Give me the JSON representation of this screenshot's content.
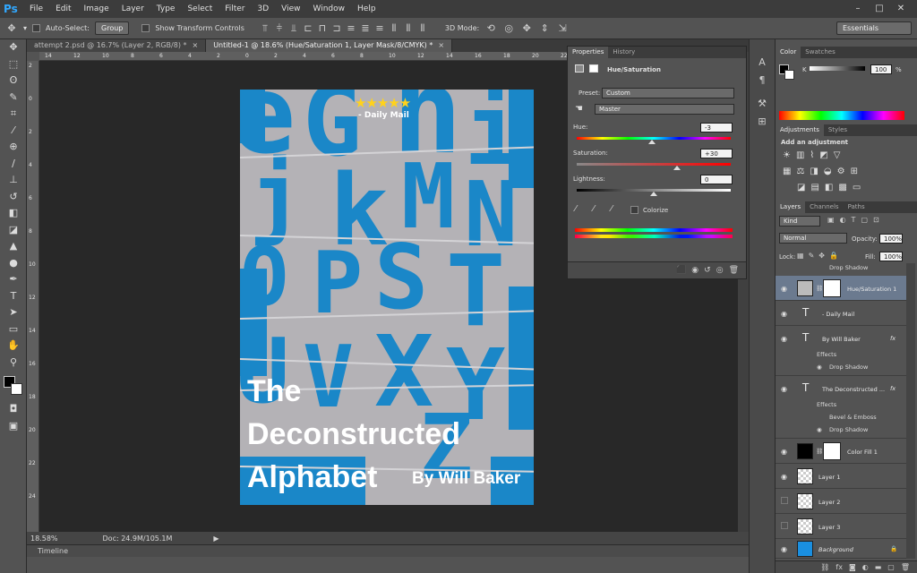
{
  "app": {
    "logo": "Ps"
  },
  "menu": [
    "File",
    "Edit",
    "Image",
    "Layer",
    "Type",
    "Select",
    "Filter",
    "3D",
    "View",
    "Window",
    "Help"
  ],
  "window_controls": [
    "–",
    "□",
    "✕"
  ],
  "options": {
    "auto_select_label": "Auto-Select:",
    "auto_select_value": "Group",
    "transform_label": "Show Transform Controls",
    "mode_label": "3D Mode:",
    "workspace": "Essentials"
  },
  "doc_tabs": [
    {
      "label": "attempt 2.psd @ 16.7% (Layer 2, RGB/8) *",
      "active": false
    },
    {
      "label": "Untitled-1 @ 18.6% (Hue/Saturation 1, Layer Mask/8/CMYK) *",
      "active": true
    }
  ],
  "tab_close": "×",
  "ruler": {
    "h": [
      "14",
      "12",
      "10",
      "8",
      "6",
      "4",
      "2",
      "0",
      "2",
      "4",
      "6",
      "8",
      "10",
      "12",
      "14",
      "16",
      "18",
      "20",
      "22"
    ],
    "v": [
      "2",
      "0",
      "2",
      "4",
      "6",
      "8",
      "10",
      "12",
      "14",
      "16",
      "18",
      "20",
      "22",
      "24"
    ]
  },
  "status": {
    "zoom": "18.58%",
    "doc": "Doc: 24.9M/105.1M"
  },
  "timeline": "Timeline",
  "poster": {
    "stars": "★★★★★",
    "dailymail": "- Daily Mail",
    "title_lines": [
      "The",
      "Deconstructed",
      "Alphabet"
    ],
    "byline": "By Will Baker",
    "letters": [
      "e",
      "G",
      "h",
      "i",
      "j",
      "k",
      "M",
      "N",
      "O",
      "P",
      "S",
      "T",
      "U",
      "V",
      "X",
      "Y",
      "Z"
    ]
  },
  "properties": {
    "tabs": [
      "Properties",
      "History"
    ],
    "adjustment": "Hue/Saturation",
    "preset_label": "Preset:",
    "preset_value": "Custom",
    "channel": "Master",
    "hue_label": "Hue:",
    "hue": "-3",
    "hue_level": 0.49,
    "sat_label": "Saturation:",
    "sat": "+30",
    "sat_level": 0.65,
    "light_label": "Lightness:",
    "light": "0",
    "light_level": 0.5,
    "colorize": "Colorize"
  },
  "color_panel": {
    "tabs": [
      "Color",
      "Swatches"
    ],
    "k_label": "K",
    "k_value": "100",
    "k_unit": "%"
  },
  "adjustments_panel": {
    "tabs": [
      "Adjustments",
      "Styles"
    ],
    "heading": "Add an adjustment"
  },
  "layers_panel": {
    "tabs": [
      "Layers",
      "Channels",
      "Paths"
    ],
    "filter": "Kind",
    "blend": "Normal",
    "opacity_label": "Opacity:",
    "opacity": "100%",
    "lock_label": "Lock:",
    "fill_label": "Fill:",
    "fill": "100%",
    "top_partial": "Drop Shadow",
    "layers": [
      {
        "name": "Hue/Saturation 1",
        "type": "adjust"
      },
      {
        "name": "- Daily Mail",
        "type": "text"
      },
      {
        "name": "By Will Baker",
        "type": "text",
        "fx": "fx",
        "effects": "Effects",
        "subs": [
          "Drop Shadow"
        ]
      },
      {
        "name": "The Deconstructed ...",
        "type": "text",
        "fx": "fx",
        "effects": "Effects",
        "subs": [
          "Bevel & Emboss",
          "Drop Shadow"
        ]
      },
      {
        "name": "Color Fill 1",
        "type": "fill"
      },
      {
        "name": "Layer 1",
        "type": "pixel"
      },
      {
        "name": "Layer 2",
        "type": "pixel"
      },
      {
        "name": "Layer 3",
        "type": "pixel"
      },
      {
        "name": "Background",
        "type": "bg"
      }
    ]
  },
  "colors": {
    "poster_blue": "#1a87c8",
    "poster_gray": "#b4b2b6",
    "selection": "#6b7a8f",
    "star": "#ffd21c"
  }
}
